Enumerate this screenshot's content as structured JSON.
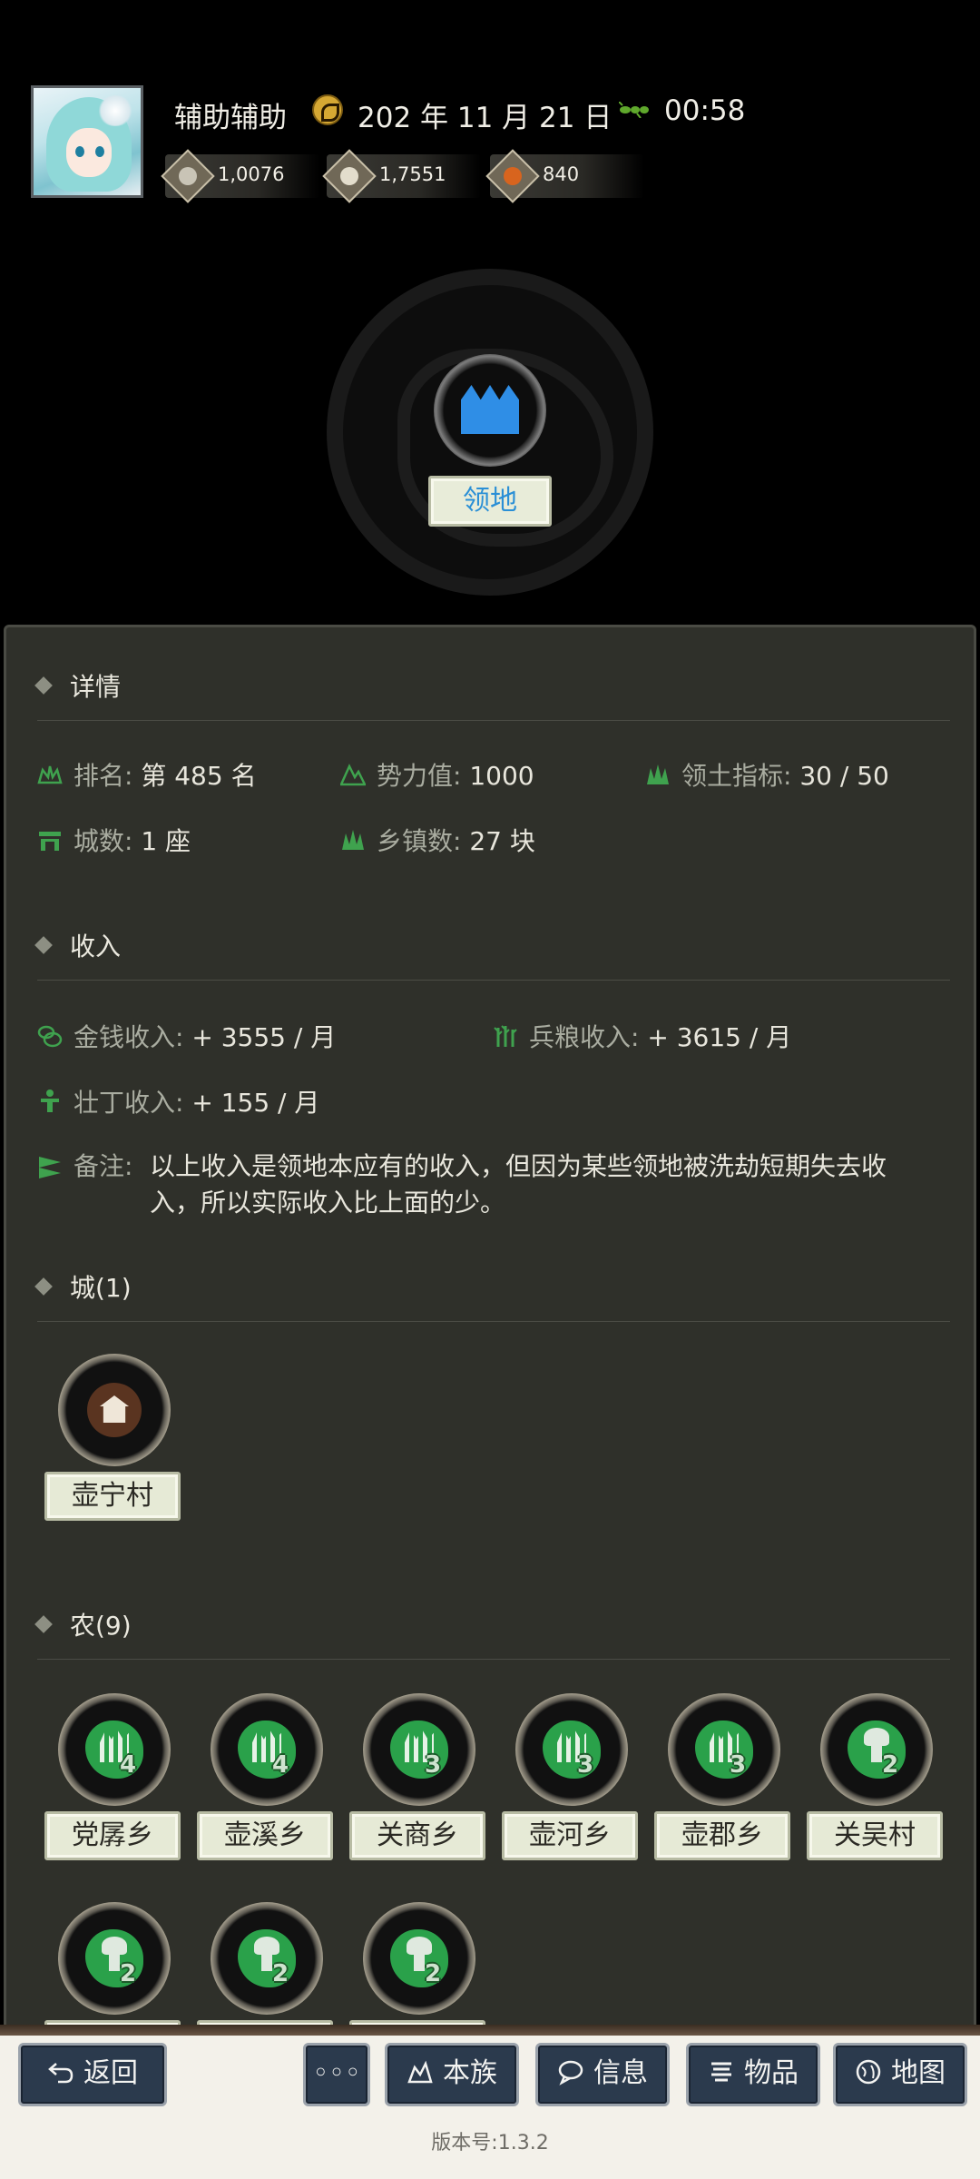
{
  "header": {
    "user_name": "辅助辅助",
    "date": "202 年 11 月 21 日",
    "time": "00:58",
    "resources": [
      {
        "icon": "silver-coin-icon",
        "value": "1,0076"
      },
      {
        "icon": "grain-bowl-icon",
        "value": "1,7551"
      },
      {
        "icon": "manpower-icon",
        "value": "840"
      }
    ],
    "territory_button": "领地"
  },
  "details": {
    "title": "详情",
    "rank_label": "排名:",
    "rank_value": "第 485 名",
    "power_label": "势力值:",
    "power_value": "1000",
    "territory_index_label": "领土指标:",
    "territory_index_value": "30 / 50",
    "cities_label": "城数:",
    "cities_value": "1 座",
    "towns_label": "乡镇数:",
    "towns_value": "27 块"
  },
  "income": {
    "title": "收入",
    "money_label": "金钱收入:",
    "money_value": "+ 3555 / 月",
    "grain_label": "兵粮收入:",
    "grain_value": "+ 3615 / 月",
    "men_label": "壮丁收入:",
    "men_value": "+ 155 / 月",
    "note_label": "备注:",
    "note_text": "以上收入是领地本应有的收入，但因为某些领地被洗劫短期失去收入，所以实际收入比上面的少。"
  },
  "cities": {
    "title": "城(1)",
    "items": [
      {
        "name": "壶宁村"
      }
    ]
  },
  "farms": {
    "title": "农(9)",
    "items": [
      {
        "name": "党孱乡",
        "level": "4",
        "type": "farm"
      },
      {
        "name": "壶溪乡",
        "level": "4",
        "type": "farm"
      },
      {
        "name": "关商乡",
        "level": "3",
        "type": "farm"
      },
      {
        "name": "壶河乡",
        "level": "3",
        "type": "farm"
      },
      {
        "name": "壶郡乡",
        "level": "3",
        "type": "farm"
      },
      {
        "name": "关吴村",
        "level": "2",
        "type": "mushroom"
      },
      {
        "name": "",
        "level": "2",
        "type": "mushroom"
      },
      {
        "name": "",
        "level": "2",
        "type": "mushroom"
      },
      {
        "name": "",
        "level": "2",
        "type": "mushroom"
      }
    ]
  },
  "nav": {
    "back": "返回",
    "more": "◦◦◦",
    "clan": "本族",
    "info": "信息",
    "items": "物品",
    "map": "地图"
  },
  "version": "版本号:1.3.2",
  "colors": {
    "accent_blue": "#2a8fd6",
    "green_icon": "#2aa14a",
    "panel_bg": "#2f302a",
    "nav_button": "#2b3a4d"
  }
}
